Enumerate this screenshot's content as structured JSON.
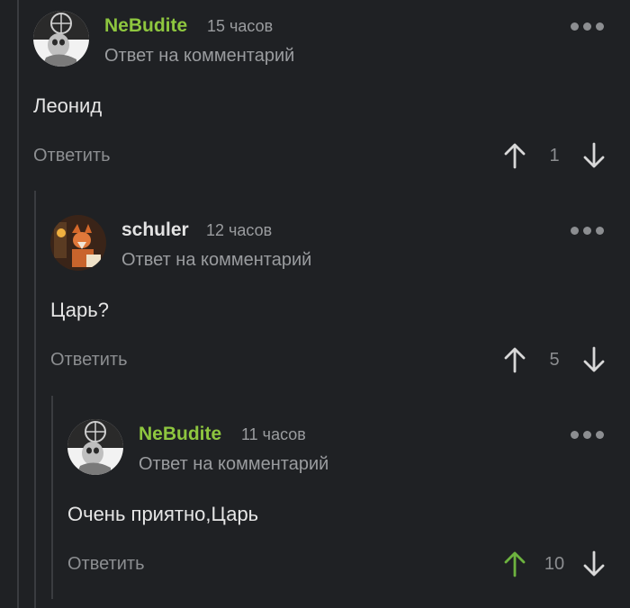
{
  "colors": {
    "background": "#1f2124",
    "nebudite_name": "#8ec63f",
    "schuler_name": "#e2e2e2",
    "upvoted": "#6db33f",
    "neutral_arrow": "#d8d8d8"
  },
  "comments": [
    {
      "username": "NeBudite",
      "time": "15 часов",
      "subtitle": "Ответ на комментарий",
      "text": "Леонид",
      "reply_label": "Ответить",
      "score": "1",
      "upvoted": false,
      "avatar": "skull-helmet-avatar"
    },
    {
      "username": "schuler",
      "time": "12 часов",
      "subtitle": "Ответ на комментарий",
      "text": "Царь?",
      "reply_label": "Ответить",
      "score": "5",
      "upvoted": false,
      "avatar": "fox-reading-avatar"
    },
    {
      "username": "NeBudite",
      "time": "11 часов",
      "subtitle": "Ответ на комментарий",
      "text": "Очень приятно,Царь",
      "reply_label": "Ответить",
      "score": "10",
      "upvoted": true,
      "avatar": "skull-helmet-avatar"
    }
  ]
}
